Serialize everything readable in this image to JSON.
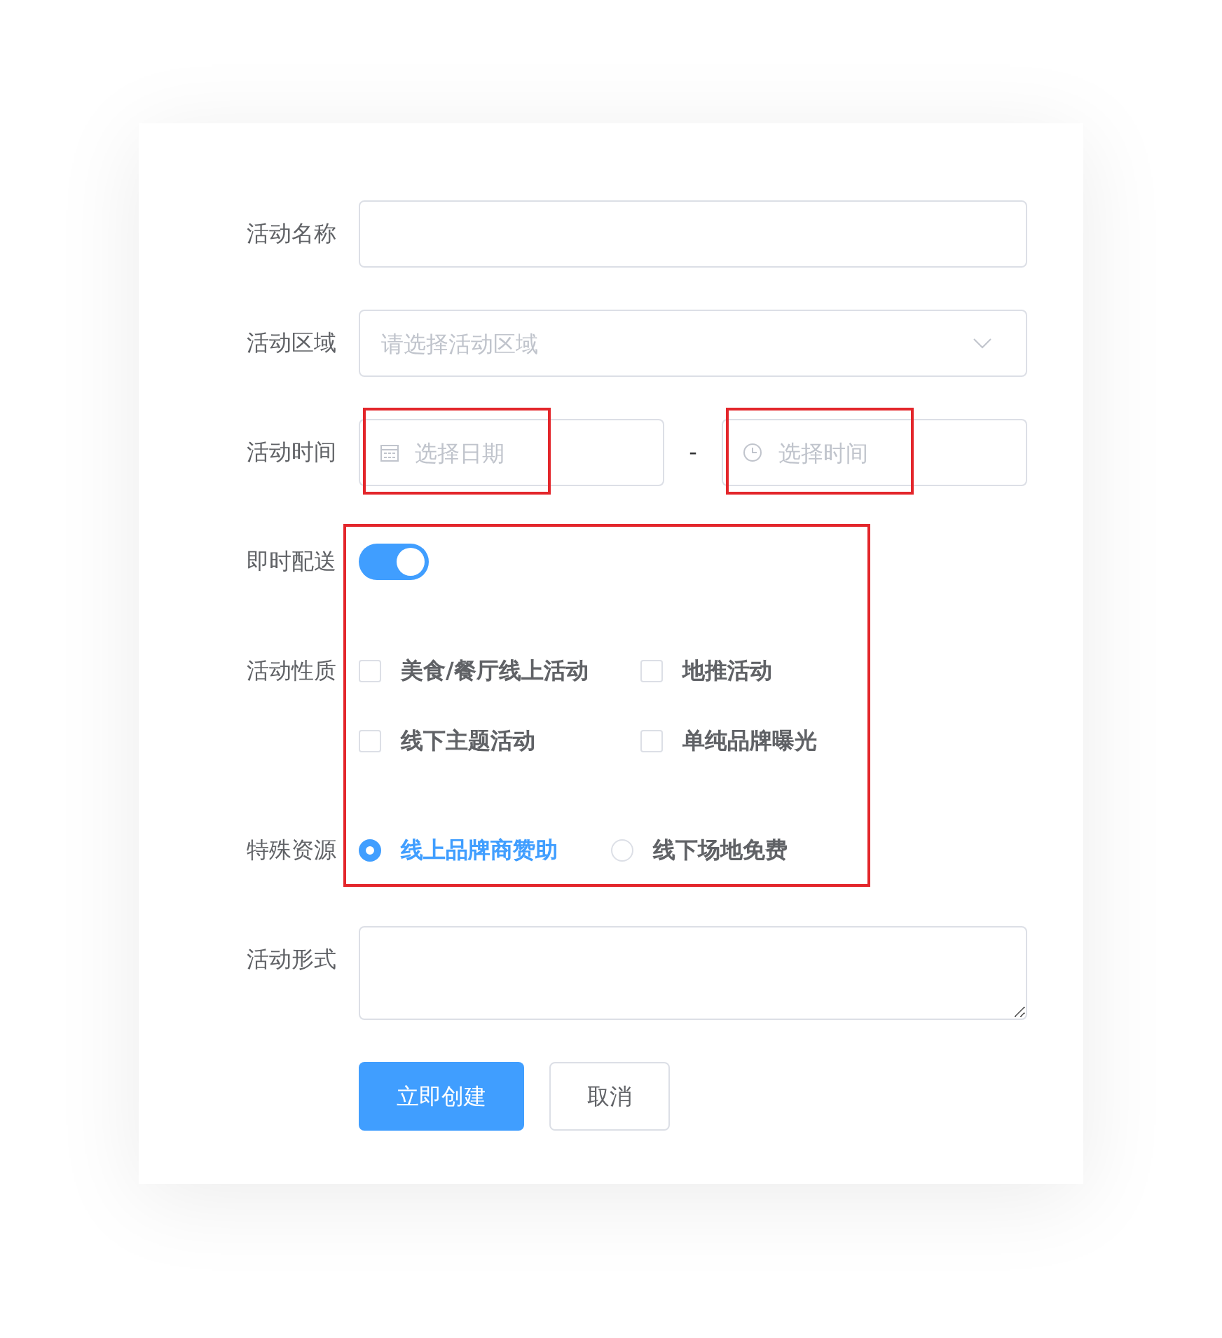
{
  "form": {
    "fields": [
      {
        "kind": "input",
        "label": "活动名称"
      },
      {
        "kind": "select",
        "label": "活动区域",
        "placeholder": "请选择活动区域"
      },
      {
        "kind": "datetime",
        "label": "活动时间",
        "date": {
          "placeholder": "选择日期",
          "highlighted": true
        },
        "separator": "-",
        "time": {
          "placeholder": "选择时间",
          "highlighted": true
        }
      },
      {
        "kind": "switch",
        "label": "即时配送",
        "on": true,
        "highlighted": true
      },
      {
        "kind": "checkboxes",
        "label": "活动性质",
        "highlighted": true,
        "options": [
          {
            "label": "美食/餐厅线上活动",
            "checked": false
          },
          {
            "label": "地推活动",
            "checked": false
          },
          {
            "label": "线下主题活动",
            "checked": false
          },
          {
            "label": "单纯品牌曝光",
            "checked": false
          }
        ]
      },
      {
        "kind": "radios",
        "label": "特殊资源",
        "highlighted": true,
        "options": [
          {
            "label": "线上品牌商赞助",
            "selected": true
          },
          {
            "label": "线下场地免费",
            "selected": false
          }
        ]
      },
      {
        "kind": "textarea",
        "label": "活动形式"
      }
    ],
    "buttons": [
      {
        "label": "立即创建",
        "kind": "primary"
      },
      {
        "label": "取消",
        "kind": "default"
      }
    ]
  }
}
